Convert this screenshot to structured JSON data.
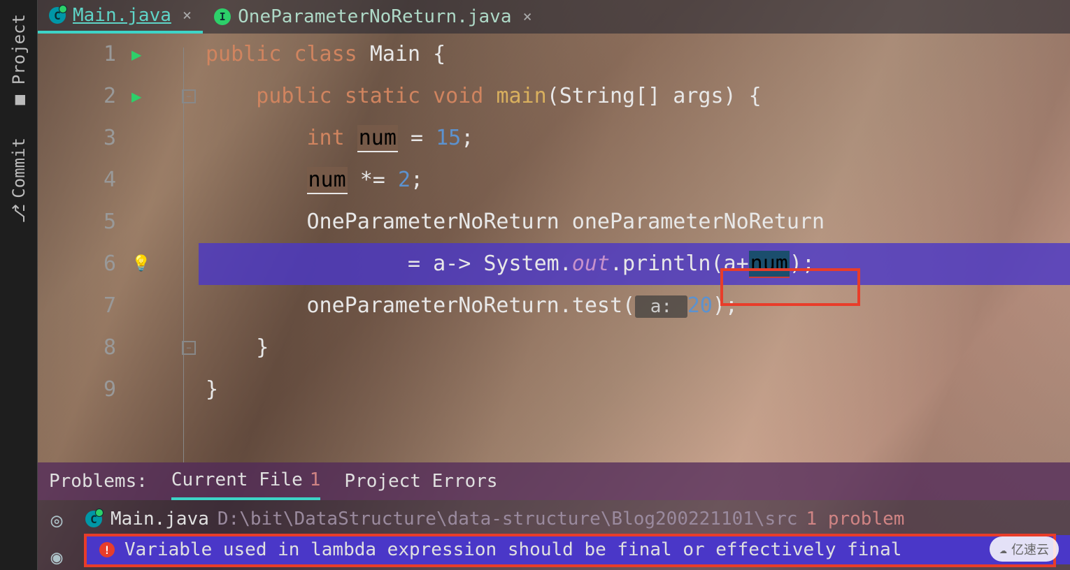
{
  "toolbar": {
    "project": "Project",
    "commit": "Commit"
  },
  "tabs": [
    {
      "label": "Main.java",
      "icon": "C",
      "active": true
    },
    {
      "label": "OneParameterNoReturn.java",
      "icon": "I",
      "active": false
    }
  ],
  "code": {
    "lines": [
      "1",
      "2",
      "3",
      "4",
      "5",
      "6",
      "7",
      "8",
      "9"
    ],
    "l1": {
      "kw1": "public",
      "kw2": "class",
      "name": "Main",
      "brace": " {"
    },
    "l2": {
      "kw1": "public",
      "kw2": "static",
      "kw3": "void",
      "method": "main",
      "params": "(String[] args) {"
    },
    "l3": {
      "type": "int",
      "var": "num",
      "eq": " = ",
      "val": "15",
      "sc": ";"
    },
    "l4": {
      "var": "num",
      "op": " *= ",
      "val": "2",
      "sc": ";"
    },
    "l5": {
      "text": "OneParameterNoReturn oneParameterNoReturn"
    },
    "l6": {
      "pre": "        = a-> System.",
      "out": "out",
      "mid": ".println",
      "open": "(a+",
      "err": "num",
      "close": ");"
    },
    "l7": {
      "pre": "oneParameterNoReturn.test(",
      "hint": " a: ",
      "val": "20",
      "close": ");"
    },
    "l8": {
      "brace": "}"
    },
    "l9": {
      "brace": "}"
    }
  },
  "problems": {
    "label": "Problems:",
    "current_file": "Current File",
    "current_count": "1",
    "project_errors": "Project Errors",
    "file_name": "Main.java",
    "file_path": "D:\\bit\\DataStructure\\data-structure\\Blog200221101\\src",
    "problem_count": "1 problem",
    "error_msg": "Variable used in lambda expression should be final or effectively final"
  },
  "watermark": "亿速云"
}
